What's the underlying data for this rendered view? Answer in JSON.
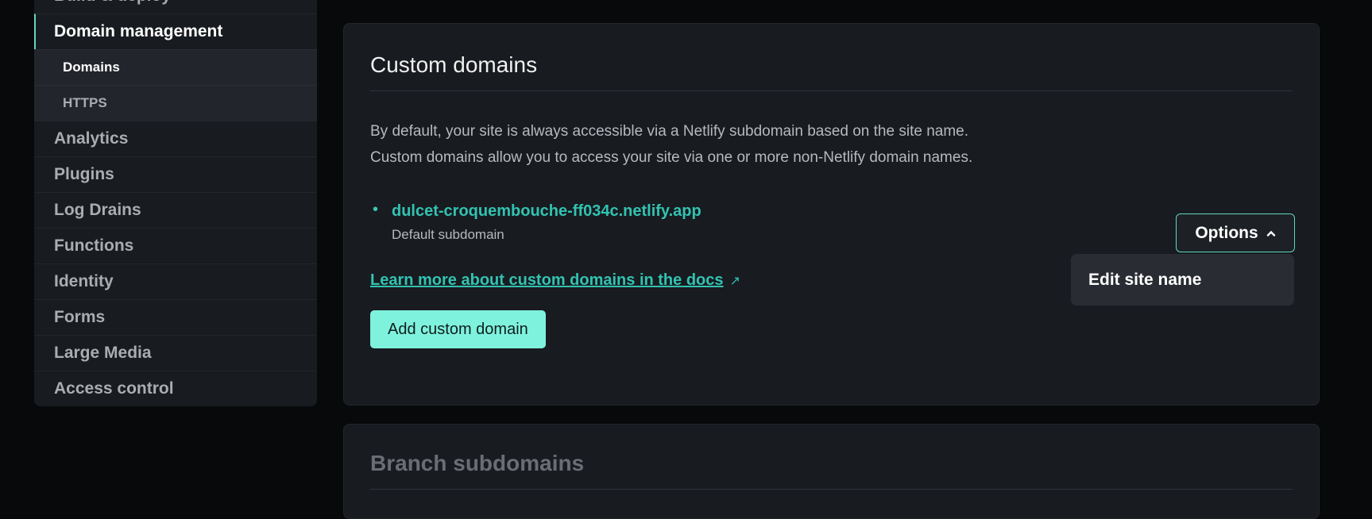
{
  "sidebar": {
    "items": [
      {
        "label": "Build & deploy"
      },
      {
        "label": "Domain management",
        "active": true,
        "children": [
          {
            "label": "Domains",
            "current": true
          },
          {
            "label": "HTTPS"
          }
        ]
      },
      {
        "label": "Analytics"
      },
      {
        "label": "Plugins"
      },
      {
        "label": "Log Drains"
      },
      {
        "label": "Functions"
      },
      {
        "label": "Identity"
      },
      {
        "label": "Forms"
      },
      {
        "label": "Large Media"
      },
      {
        "label": "Access control"
      }
    ]
  },
  "custom_domains": {
    "title": "Custom domains",
    "desc1": "By default, your site is always accessible via a Netlify subdomain based on the site name.",
    "desc2": "Custom domains allow you to access your site via one or more non-Netlify domain names.",
    "domain": "dulcet-croquembouche-ff034c.netlify.app",
    "domain_note": "Default subdomain",
    "learn_more": "Learn more about custom domains in the docs",
    "add_button": "Add custom domain",
    "options_button": "Options",
    "options_menu": [
      "Edit site name"
    ]
  },
  "branch_subdomains": {
    "title": "Branch subdomains"
  },
  "colors": {
    "accent": "#32c3b1",
    "button": "#7ff2de",
    "background": "#07090b",
    "card": "#181b20"
  }
}
